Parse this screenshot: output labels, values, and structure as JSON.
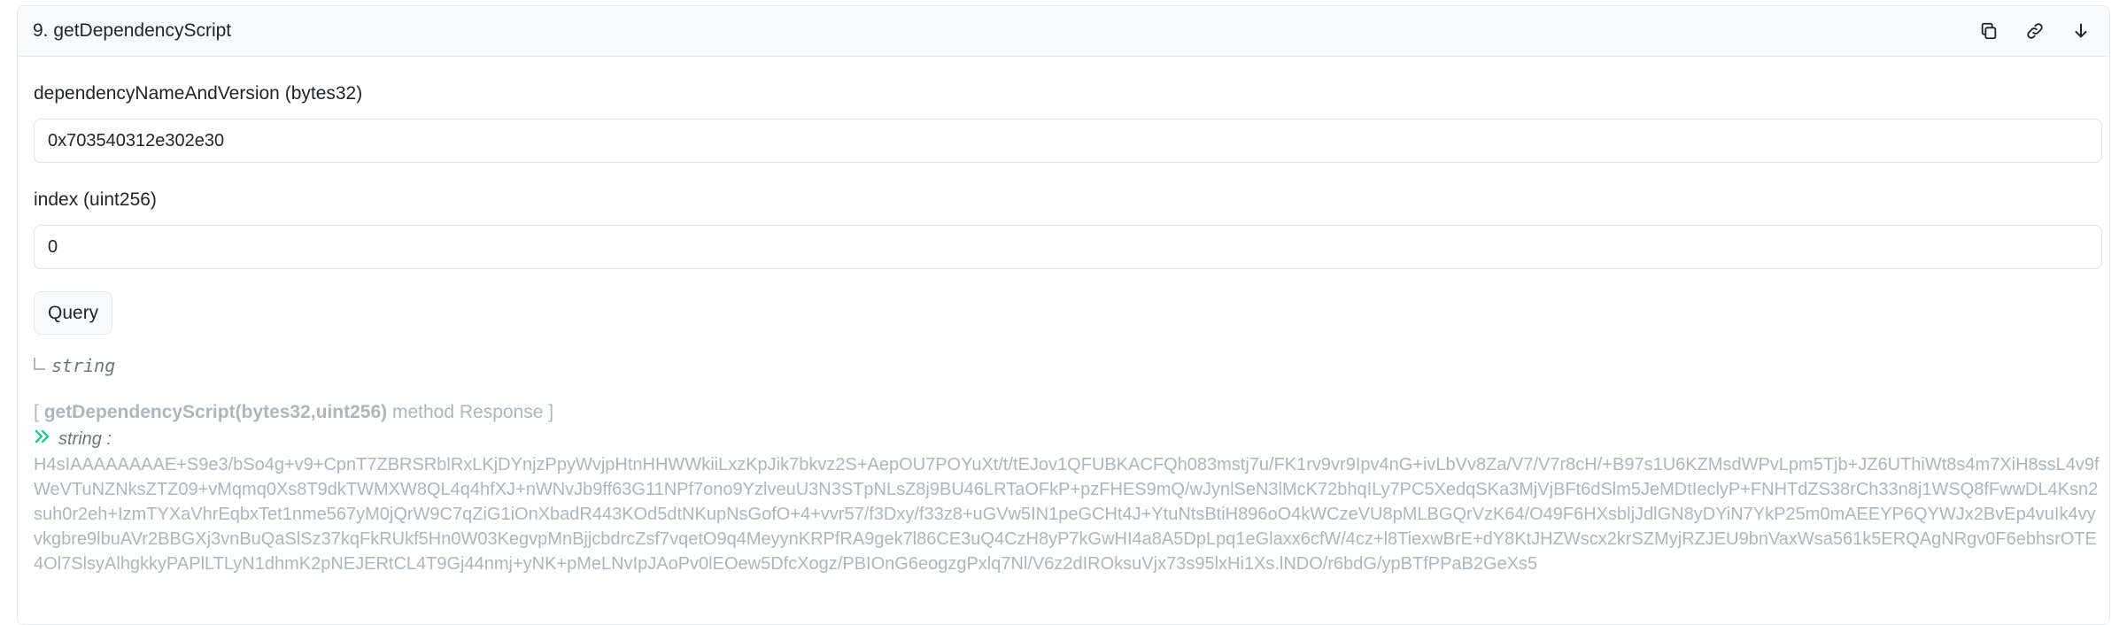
{
  "header": {
    "title": "9. getDependencyScript",
    "icons": [
      "copy-icon",
      "link-icon",
      "arrow-down-icon"
    ]
  },
  "inputs": [
    {
      "label": "dependencyNameAndVersion (bytes32)",
      "value": "0x703540312e302e30"
    },
    {
      "label": "index (uint256)",
      "value": "0"
    }
  ],
  "query_label": "Query",
  "output_type": "string",
  "response": {
    "open": "[",
    "method": "getDependencyScript(bytes32,uint256)",
    "suffix": "method Response ]",
    "type_label": "string :",
    "value": "H4sIAAAAAAAAE+S9e3/bSo4g+v9+CpnT7ZBRSRblRxLKjDYnjzPpyWvjpHtnHHWWkiiLxzKpJik7bkvz2S+AepOU7POYuXt/t/tEJov1QFUBKACFQh083mstj7u/FK1rv9vr9Ipv4nG+ivLbVv8Za/V7/V7r8cH/+B97s1U6KZMsdWPvLpm5Tjb+JZ6UThiWt8s4m7XiH8ssL4v9fWeVTuNZNksZTZ09+vMqmq0Xs8T9dkTWMXW8QL4q4hfXJ+nWNvJb9ff63G11NPf7ono9YzlveuU3N3STpNLsZ8j9BU46LRTaOFkP+pzFHES9mQ/wJynlSeN3lMcK72bhqILy7PC5XedqSKa3MjVjBFt6dSlm5JeMDtIeclyP+FNHTdZS38rCh33n8j1WSQ8fFwwDL4Ksn2suh0r2eh+IzmTYXaVhrEqbxTet1nme567yM0jQrW9C7qZiG1iOnXbadR443KOd5dtNKupNsGofO+4+vvr57/f3Dxy/f33z8+uGVw5IN1peGCHt4J+YtuNtsBtiH896oO4kWCzeVU8pMLBGQrVzK64/O49F6HXsbljJdlGN8yDYiN7YkP25m0mAEEYP6QYWJx2BvEp4vuIk4vyvkgbre9lbuAVr2BBGXj3vnBuQaSlSz37kqFkRUkf5Hn0W03KegvpMnBjjcbdrcZsf7vqetO9q4MeyynKRPfRA9gek7l86CE3uQ4CzH8yP7kGwHI4a8A5DpLpq1eGlaxx6cfW/4cz+l8TiexwBrE+dY8KtJHZWscx2krSZMyjRZJEU9bnVaxWsa561k5ERQAgNRgv0F6ebhsrOTE4Ol7SlsyAlhgkkyPAPlLTLyN1dhmK2pNEJERtCL4T9Gj44nmj+yNK+pMeLNvIpJAoPv0lEOew5DfcXogz/PBIOnG6eogzgPxlq7Nl/V6z2dIROksuVjx73s95lxHi1Xs.lNDO/r6bdG/ypBTfPPaB2GeXs5"
  }
}
